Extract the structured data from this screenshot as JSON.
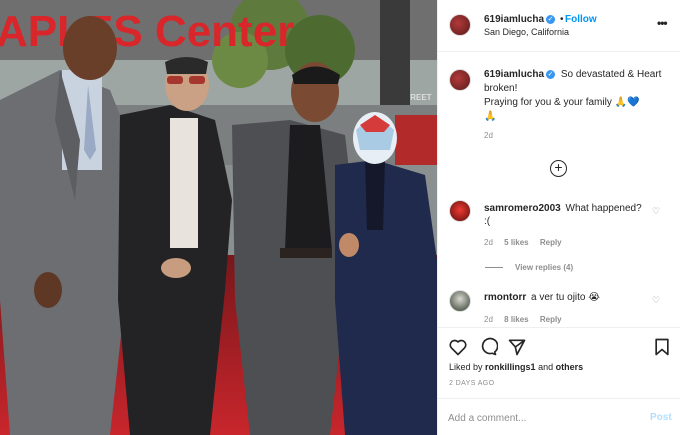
{
  "photo": {
    "sign_text": "APLES Center",
    "sign_text_right": "STREET",
    "alt": "Four men posing on a red carpet"
  },
  "header": {
    "username": "619iamlucha",
    "separator": "•",
    "follow_label": "Follow",
    "location": "San Diego, California",
    "more_icon": "more-horizontal-icon"
  },
  "caption": {
    "username": "619iamlucha",
    "text": "So devastated & Heart broken!",
    "text2": "Praying for you & your family 🙏💙",
    "text3": "🙏",
    "time": "2d"
  },
  "load_more_icon": "plus-circle-icon",
  "comments": [
    {
      "username": "samromero2003",
      "text": "What happened? :(",
      "time": "2d",
      "likes": "5 likes",
      "reply": "Reply",
      "avatar_color": "#c8201f"
    },
    {
      "username": "rmontorr",
      "text": "a ver tu ojito 😭",
      "time": "2d",
      "likes": "8 likes",
      "reply": "Reply",
      "avatar_color": "#2f3a2c"
    }
  ],
  "view_replies": "View replies (4)",
  "actions": {
    "like_icon": "heart-icon",
    "comment_icon": "comment-icon",
    "share_icon": "send-icon",
    "save_icon": "bookmark-icon"
  },
  "likes_line": {
    "prefix": "Liked by",
    "user": "ronkillings1",
    "mid": "and",
    "others": "others"
  },
  "date": "2 DAYS AGO",
  "add_comment": {
    "placeholder": "Add a comment...",
    "post_label": "Post"
  },
  "colors": {
    "accent": "#0095f6",
    "post_disabled": "#b2dffc",
    "carpet": "#c8262c",
    "verified": "#3897f0"
  }
}
